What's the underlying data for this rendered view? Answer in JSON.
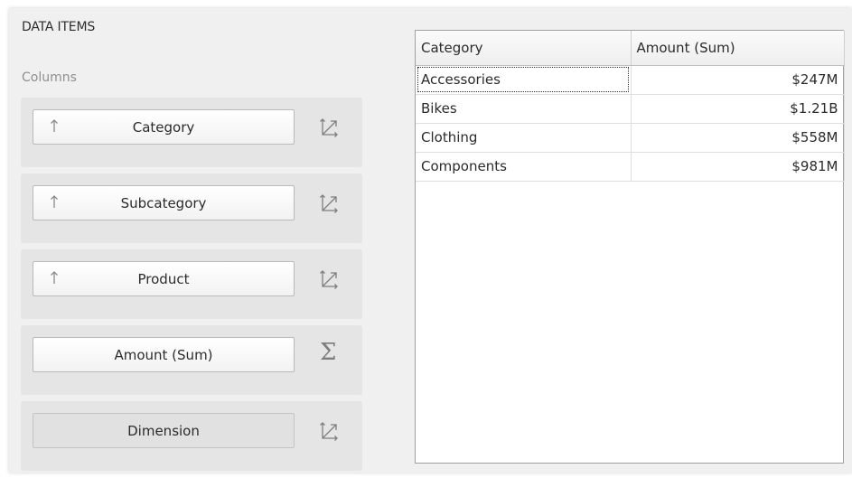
{
  "panel": {
    "title": "DATA ITEMS",
    "section_label": "Columns"
  },
  "data_items": [
    {
      "label": "Category",
      "sort_icon": "sort-ascending-arrow",
      "side_icon": "dimension-axis-icon",
      "placeholder": false
    },
    {
      "label": "Subcategory",
      "sort_icon": "sort-ascending-arrow",
      "side_icon": "dimension-axis-icon",
      "placeholder": false
    },
    {
      "label": "Product",
      "sort_icon": "sort-ascending-arrow",
      "side_icon": "dimension-axis-icon",
      "placeholder": false
    },
    {
      "label": "Amount (Sum)",
      "sort_icon": null,
      "side_icon": "sigma-measure-icon",
      "placeholder": false
    },
    {
      "label": "Dimension",
      "sort_icon": null,
      "side_icon": "dimension-axis-icon",
      "placeholder": true
    }
  ],
  "grid": {
    "columns": [
      "Category",
      "Amount (Sum)"
    ],
    "rows": [
      [
        "Accessories",
        "$247M"
      ],
      [
        "Bikes",
        "$1.21B"
      ],
      [
        "Clothing",
        "$558M"
      ],
      [
        "Components",
        "$981M"
      ]
    ]
  },
  "colors": {
    "panel_bg": "#f0f0f0",
    "row_bg": "#e5e5e5",
    "icon_gray": "#7d7d7d",
    "grid_border": "#a0a0a0"
  }
}
